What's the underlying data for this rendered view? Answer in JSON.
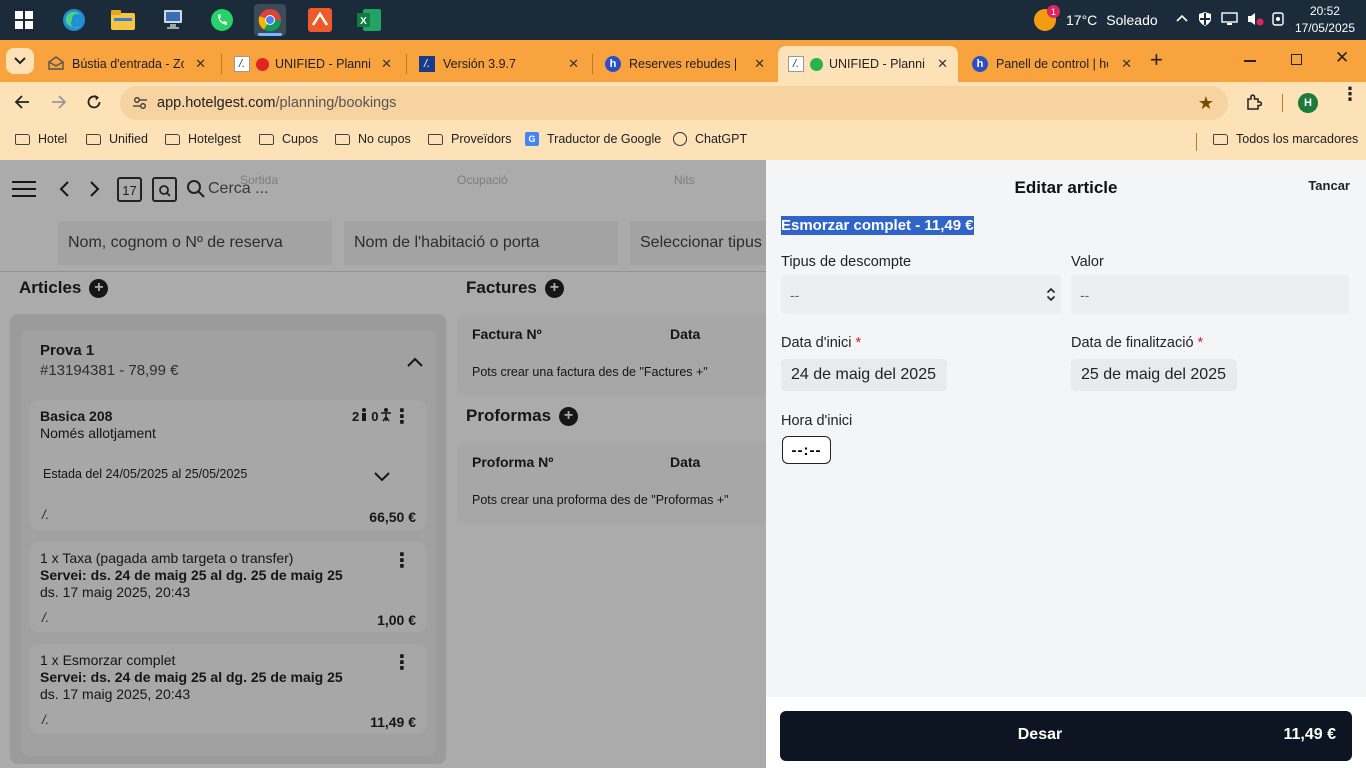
{
  "taskbar": {
    "weather": {
      "temp": "17°C",
      "condition": "Soleado",
      "badge": "1"
    },
    "clock": {
      "time": "20:52",
      "date": "17/05/2025"
    }
  },
  "browser": {
    "tabs": [
      {
        "title": "Bústia d'entrada - Zoho",
        "active": false
      },
      {
        "title": "UNIFIED - Planning",
        "active": false
      },
      {
        "title": "Versión 3.9.7",
        "active": false
      },
      {
        "title": "Reserves rebudes | hotelgest",
        "active": false
      },
      {
        "title": "UNIFIED - Planning",
        "active": true
      },
      {
        "title": "Panell de control | hotelgest",
        "active": false
      }
    ],
    "url": {
      "domain": "app.hotelgest.com",
      "path": "/planning/bookings"
    },
    "profile_initial": "H",
    "bookmarks": [
      {
        "label": "Hotel",
        "icon": "folder-icon"
      },
      {
        "label": "Unified",
        "icon": "folder-icon"
      },
      {
        "label": "Hotelgest",
        "icon": "folder-icon"
      },
      {
        "label": "Cupos",
        "icon": "folder-icon"
      },
      {
        "label": "No cupos",
        "icon": "folder-icon"
      },
      {
        "label": "Proveïdors",
        "icon": "folder-icon"
      },
      {
        "label": "Traductor de Google",
        "icon": "translate-icon"
      },
      {
        "label": "ChatGPT",
        "icon": "chatgpt-icon"
      }
    ],
    "all_bookmarks": "Todos los marcadores"
  },
  "planning": {
    "calendar_day": "17",
    "search_placeholder": "Cerca ...",
    "faded_headers": [
      "Sortida",
      "Ocupació",
      "Nits"
    ],
    "filters": {
      "name": "Nom, cognom o Nº de reserva",
      "room": "Nom de l'habitació o porta",
      "type": "Seleccionar tipus"
    },
    "articles_title": "Articles",
    "booking": {
      "name": "Prova 1",
      "ref": "#13194381 - 78,99 €",
      "room_item": {
        "room": "Basica 208",
        "board": "Només allotjament",
        "adults": "2",
        "children": "0",
        "stay": "Estada del 24/05/2025 al 25/05/2025",
        "price": "66,50 €"
      },
      "extras": [
        {
          "title": "1 x Taxa (pagada amb targeta o transfer)",
          "service": "Servei: ds. 24 de maig 25 al dg. 25 de maig 25",
          "created": "ds. 17 maig 2025, 20:43",
          "price": "1,00 €"
        },
        {
          "title": "1 x Esmorzar complet",
          "service": "Servei: ds. 24 de maig 25 al dg. 25 de maig 25",
          "created": "ds. 17 maig 2025, 20:43",
          "price": "11,49 €"
        }
      ]
    },
    "invoices": {
      "title": "Factures",
      "col_number": "Factura Nº",
      "col_date": "Data",
      "empty": "Pots crear una factura des de \"Factures +\""
    },
    "proformas": {
      "title": "Proformas",
      "col_number": "Proforma Nº",
      "col_date": "Data",
      "empty": "Pots crear una proforma des de \"Proformas +\""
    }
  },
  "edit_panel": {
    "title": "Editar article",
    "cancel": "Tancar",
    "selected_item": "Esmorzar complet - 11,49 €",
    "discount_type_label": "Tipus de descompte",
    "discount_type_value": "--",
    "value_label": "Valor",
    "value_placeholder": "--",
    "start_date_label": "Data d'inici",
    "start_date": "24 de maig del 2025",
    "end_date_label": "Data de finalització",
    "end_date": "25 de maig del 2025",
    "start_time_label": "Hora d'inici",
    "start_time": "--:--",
    "required_mark": "*",
    "save_label": "Desar",
    "save_amount": "11,49 €"
  },
  "colors": {
    "browser_tabstrip": "#f8a33d",
    "browser_toolbar": "#fde2b8",
    "save_button": "#0e1522",
    "selection": "#2f64c9",
    "required": "#d21f1f"
  }
}
